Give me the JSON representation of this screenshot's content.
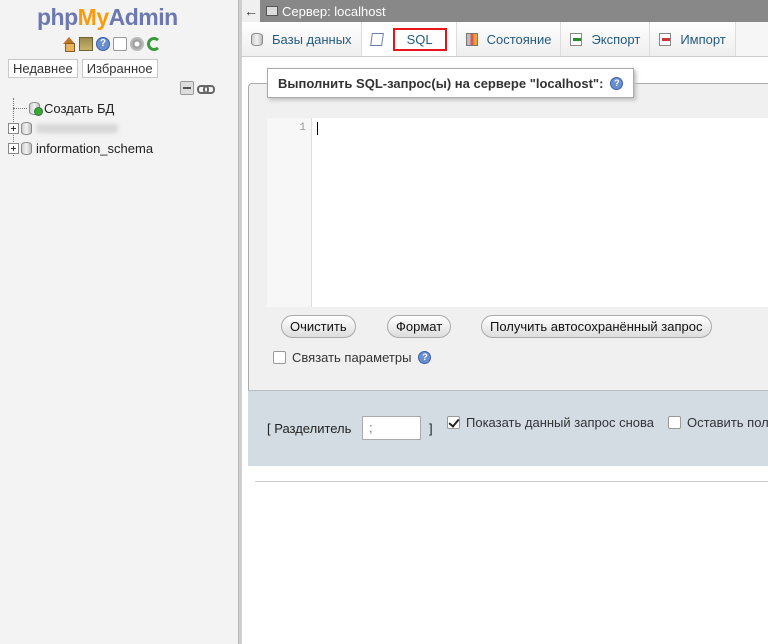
{
  "nav": {
    "logo_php": "php",
    "logo_my": "My",
    "logo_admin": "Admin",
    "icons": [
      "home-icon",
      "database-icon",
      "help-icon",
      "documentation-icon",
      "settings-icon",
      "reload-icon"
    ],
    "tab_recent": "Недавнее",
    "tab_favorites": "Избранное",
    "tree": {
      "create_db": "Создать БД",
      "db_blurred": "",
      "db_info_schema": "information_schema"
    }
  },
  "topbar": {
    "back": "←",
    "server": "Сервер: localhost"
  },
  "tabs": [
    {
      "label": "Базы данных",
      "icon": "database-icon"
    },
    {
      "label": "SQL",
      "icon": "sql-icon"
    },
    {
      "label": "Состояние",
      "icon": "status-icon"
    },
    {
      "label": "Экспорт",
      "icon": "export-icon"
    },
    {
      "label": "Импорт",
      "icon": "import-icon"
    }
  ],
  "main": {
    "legend": "Выполнить SQL-запрос(ы) на сервере \"localhost\":",
    "editor": {
      "line_number": "1",
      "content": ""
    },
    "buttons": {
      "clear": "Очистить",
      "format": "Формат",
      "autosaved": "Получить автосохранённый запрос"
    },
    "bind_params": {
      "label": "Связать параметры",
      "checked": false
    },
    "delimiter": {
      "label": "[ Разделитель",
      "value": ";",
      "close": "]"
    },
    "show_query": {
      "label": "Показать данный запрос снова",
      "checked": true
    },
    "retain": {
      "label": "Оставить пол",
      "checked": false
    }
  },
  "colors": {
    "logo_blue": "#6c78af",
    "logo_orange": "#f89c0e",
    "tab_text": "#235a81",
    "highlight_red": "#e8141a",
    "bottom_panel": "#d3dce3"
  }
}
